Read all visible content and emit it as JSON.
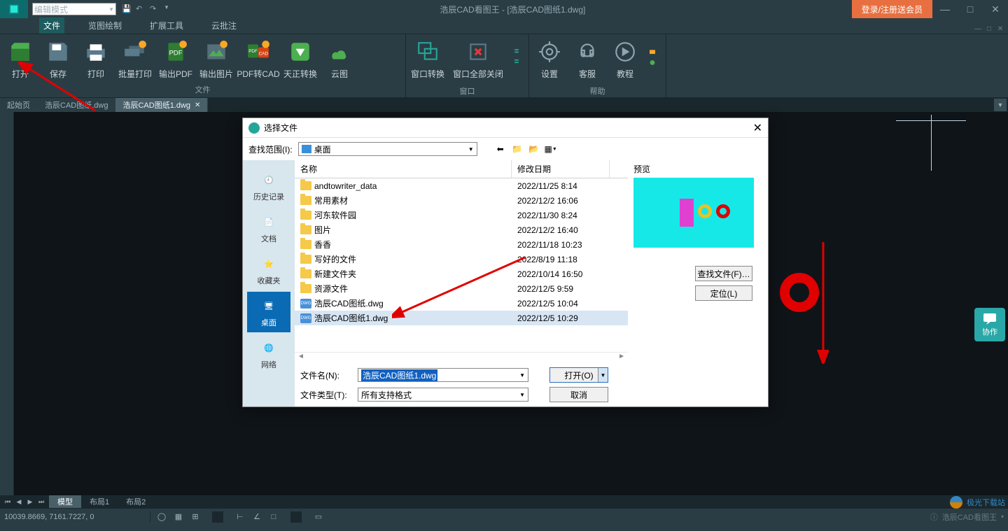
{
  "titlebar": {
    "mode": "编辑模式",
    "title": "浩辰CAD看图王 - [浩辰CAD图纸1.dwg]",
    "login": "登录/注册送会员"
  },
  "ribbon_tabs": [
    "文件",
    "览图绘制",
    "扩展工具",
    "云批注"
  ],
  "ribbon": {
    "group_file": {
      "label": "文件",
      "buttons": {
        "open": "打开",
        "save": "保存",
        "print": "打印",
        "batch_print": "批量打印",
        "export_pdf": "输出PDF",
        "export_img": "输出图片",
        "pdf2cad": "PDF转CAD",
        "tz_convert": "天正转换",
        "cloud": "云图"
      }
    },
    "group_window": {
      "label": "窗口",
      "buttons": {
        "switch": "窗口转换",
        "close_all": "窗口全部关闭"
      }
    },
    "group_help": {
      "label": "帮助",
      "buttons": {
        "settings": "设置",
        "support": "客服",
        "tutorial": "教程"
      }
    }
  },
  "doc_tabs": {
    "start": "起始页",
    "tab1": "浩辰CAD图纸.dwg",
    "tab2": "浩辰CAD图纸1.dwg"
  },
  "dialog": {
    "title": "选择文件",
    "range_label": "查找范围(I):",
    "range_value": "桌面",
    "columns": {
      "name": "名称",
      "date": "修改日期"
    },
    "sidebar": {
      "history": "历史记录",
      "docs": "文档",
      "fav": "收藏夹",
      "desktop": "桌面",
      "network": "网络"
    },
    "files": [
      {
        "name": "andtowriter_data",
        "date": "2022/11/25 8:14",
        "type": "folder"
      },
      {
        "name": "常用素材",
        "date": "2022/12/2 16:06",
        "type": "folder"
      },
      {
        "name": "河东软件园",
        "date": "2022/11/30 8:24",
        "type": "folder"
      },
      {
        "name": "图片",
        "date": "2022/12/2 16:40",
        "type": "folder"
      },
      {
        "name": "香香",
        "date": "2022/11/18 10:23",
        "type": "folder"
      },
      {
        "name": "写好的文件",
        "date": "2022/8/19 11:18",
        "type": "folder"
      },
      {
        "name": "新建文件夹",
        "date": "2022/10/14 16:50",
        "type": "folder"
      },
      {
        "name": "资源文件",
        "date": "2022/12/5 9:59",
        "type": "folder"
      },
      {
        "name": "浩辰CAD图纸.dwg",
        "date": "2022/12/5 10:04",
        "type": "dwg"
      },
      {
        "name": "浩辰CAD图纸1.dwg",
        "date": "2022/12/5 10:29",
        "type": "dwg",
        "selected": true
      }
    ],
    "preview_label": "预览",
    "find_btn": "查找文件(F)…",
    "locate_btn": "定位(L)",
    "filename_label": "文件名(N):",
    "filename_value": "浩辰CAD图纸1.dwg",
    "filetype_label": "文件类型(T):",
    "filetype_value": "所有支持格式",
    "open_btn": "打开(O)",
    "cancel_btn": "取消"
  },
  "layout_tabs": {
    "model": "模型",
    "layout1": "布局1",
    "layout2": "布局2"
  },
  "status": {
    "coords": "10039.8669, 7161.7227, 0",
    "brand": "浩辰CAD看图王"
  },
  "collab": "协作",
  "watermark": "极光下载站"
}
